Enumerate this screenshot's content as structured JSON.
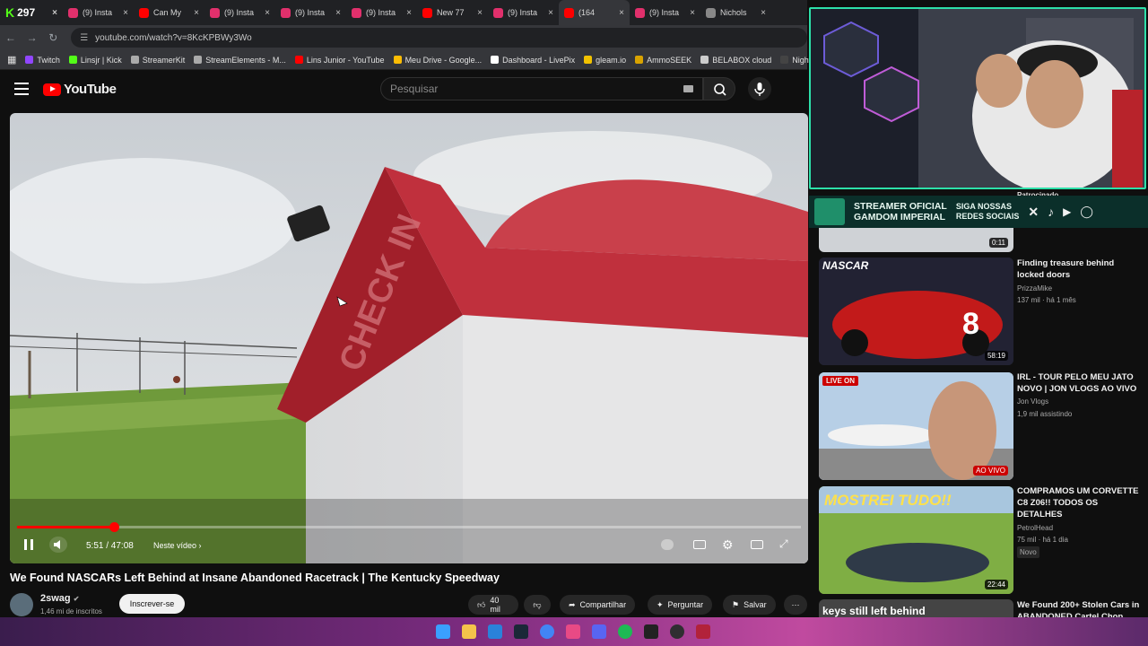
{
  "browser": {
    "tabs": [
      {
        "label": "297",
        "type": "kick",
        "color": "#53fc18"
      },
      {
        "label": "(9) Insta",
        "color": "#e1306c"
      },
      {
        "label": "Can My",
        "color": "#ff0000"
      },
      {
        "label": "(9) Insta",
        "color": "#e1306c"
      },
      {
        "label": "(9) Insta",
        "color": "#e1306c"
      },
      {
        "label": "(9) Insta",
        "color": "#e1306c"
      },
      {
        "label": "New 77",
        "color": "#ff0000"
      },
      {
        "label": "(9) Insta",
        "color": "#e1306c"
      },
      {
        "label": "(164",
        "color": "#ff0000",
        "active": true
      },
      {
        "label": "(9) Insta",
        "color": "#e1306c"
      },
      {
        "label": "Nichols",
        "color": "#888888"
      }
    ],
    "url": "youtube.com/watch?v=8KcKPBWy3Wo",
    "bookmarks": [
      {
        "label": "Twitch",
        "color": "#9146ff"
      },
      {
        "label": "Linsjr | Kick",
        "color": "#53fc18"
      },
      {
        "label": "StreamerKit",
        "color": "#aaaaaa"
      },
      {
        "label": "StreamElements - M...",
        "color": "#aaaaaa"
      },
      {
        "label": "Lins Junior - YouTube",
        "color": "#ff0000"
      },
      {
        "label": "Meu Drive - Google...",
        "color": "#fbbc04"
      },
      {
        "label": "Dashboard - LivePix",
        "color": "#ffffff"
      },
      {
        "label": "gleam.io",
        "color": "#f2c200"
      },
      {
        "label": "AmmoSEEK",
        "color": "#d9a300"
      },
      {
        "label": "BELABOX cloud",
        "color": "#cccccc"
      },
      {
        "label": "Nightbot - Comm",
        "color": "#444444"
      }
    ]
  },
  "youtube": {
    "logo_text": "YouTube",
    "search_placeholder": "Pesquisar",
    "player": {
      "time": "5:51 / 47:08",
      "chapter": "Neste vídeo",
      "progress": 0.124,
      "sign_text": "CHECK IN"
    },
    "video": {
      "title": "We Found NASCARs Left Behind at Insane Abandoned Racetrack | The Kentucky Speedway",
      "channel": "2swag",
      "subscribers": "1,46 mi de inscritos",
      "subscribe_label": "Inscrever-se",
      "likes": "40 mil",
      "share_label": "Compartilhar",
      "ask_label": "Perguntar",
      "save_label": "Salvar"
    },
    "overlay": {
      "banner_line1": "STREAMER OFICIAL",
      "banner_line2": "GAMDOM IMPERIAL",
      "banner_right1": "SIGA NOSSAS",
      "banner_right2": "REDES SOCIAIS",
      "sponsored": "Patrocinado"
    },
    "recommendations": [
      {
        "title": "",
        "duration": "0:11",
        "channel": "",
        "meta1": "",
        "meta2": ""
      },
      {
        "title": "Finding treasure behind locked doors",
        "duration": "58:19",
        "channel": "PrizzaMike",
        "meta1": "137 mil · há 1 mês",
        "thumb_text": "NASCAR"
      },
      {
        "title": "IRL - TOUR PELO MEU JATO NOVO | JON VLOGS AO VIVO",
        "duration": "AO VIVO",
        "channel": "Jon Vlogs",
        "meta1": "1,9 mil assistindo",
        "badge": "LIVE ON"
      },
      {
        "title": "COMPRAMOS UM CORVETTE C8 Z06!! TODOS OS DETALHES",
        "duration": "22:44",
        "channel": "PetrolHead",
        "meta1": "75 mil · há 1 dia",
        "tag": "Novo",
        "thumb_text": "MOSTREI TUDO!!"
      },
      {
        "title": "We Found 200+ Stolen Cars in ABANDONED Cartel Chop",
        "duration": "",
        "channel": "",
        "meta1": "",
        "thumb_text": "keys still left behind"
      }
    ]
  }
}
